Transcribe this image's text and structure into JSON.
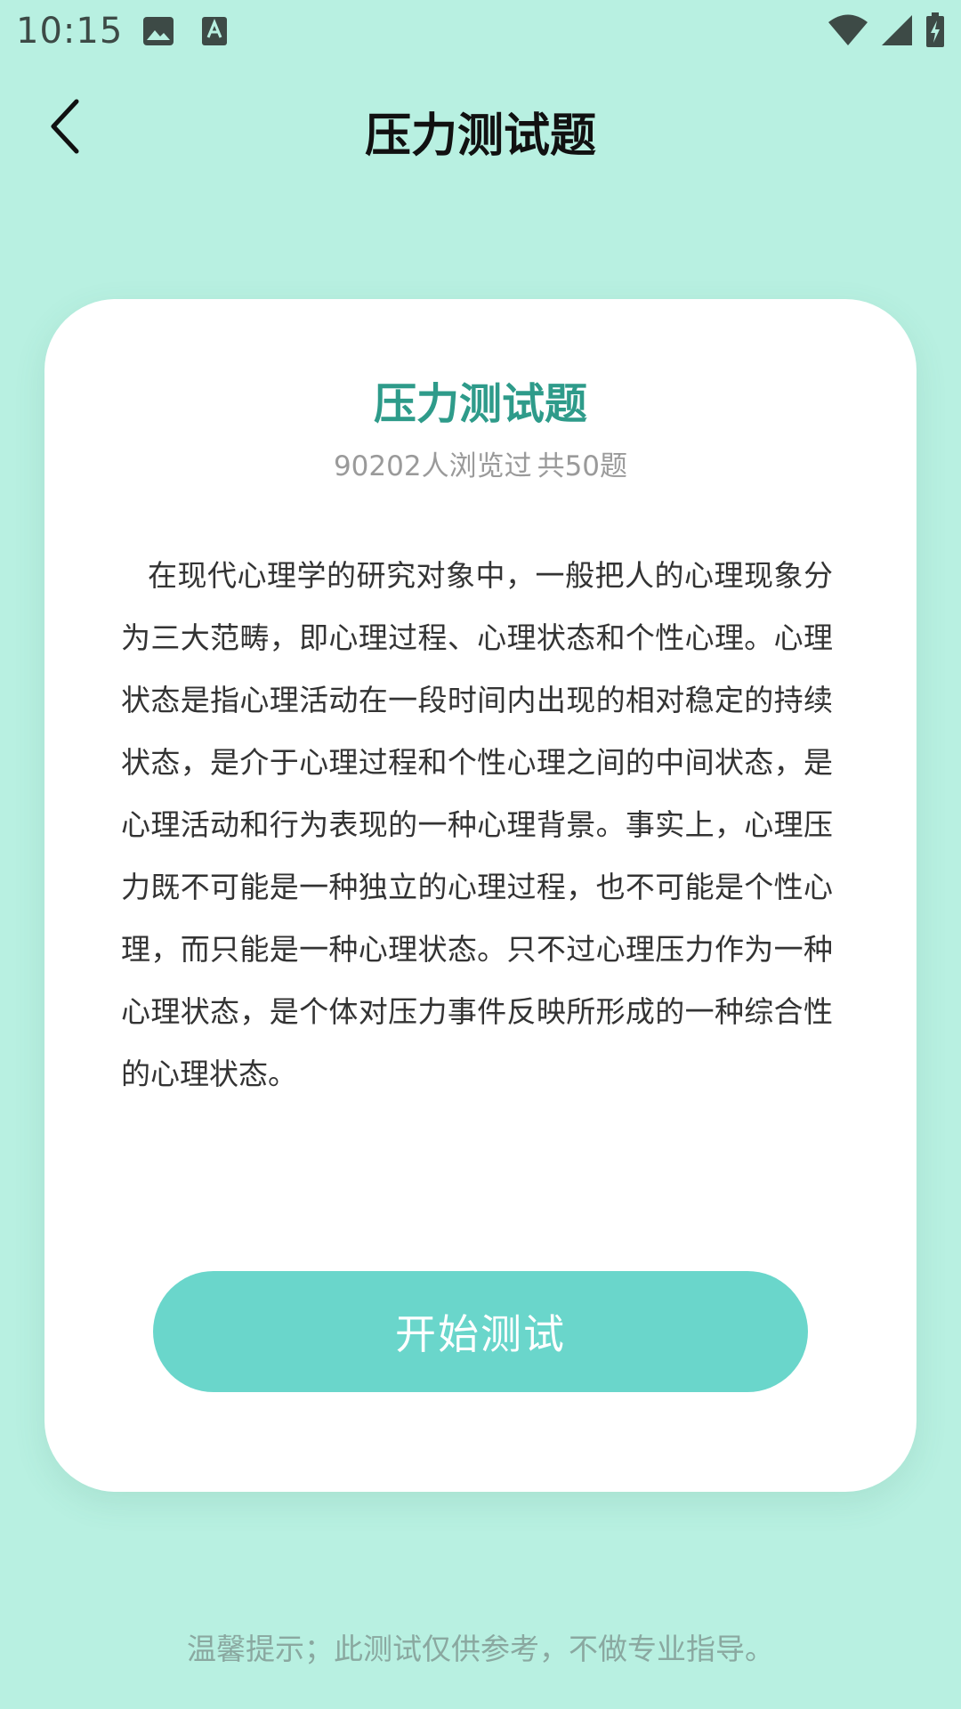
{
  "status_bar": {
    "time": "10:15",
    "icons_left": [
      "image-icon",
      "text-a-icon"
    ],
    "icons_right": [
      "wifi-icon",
      "signal-icon",
      "battery-charging-icon"
    ]
  },
  "header": {
    "back_icon": "chevron-left-icon",
    "title": "压力测试题"
  },
  "card": {
    "title": "压力测试题",
    "views": "90202人浏览过",
    "question_count": "共50题",
    "description": "在现代心理学的研究对象中，一般把人的心理现象分为三大范畴，即心理过程、心理状态和个性心理。心理状态是指心理活动在一段时间内出现的相对稳定的持续状态，是介于心理过程和个性心理之间的中间状态，是心理活动和行为表现的一种心理背景。事实上，心理压力既不可能是一种独立的心理过程，也不可能是个性心理，而只能是一种心理状态。只不过心理压力作为一种心理状态，是个体对压力事件反映所形成的一种综合性的心理状态。",
    "start_button": "开始测试"
  },
  "footer": {
    "tip": "温馨提示；此测试仅供参考，不做专业指导。"
  },
  "colors": {
    "background": "#b8f0e1",
    "accent": "#2e9b8a",
    "button": "#6ad6cb"
  }
}
